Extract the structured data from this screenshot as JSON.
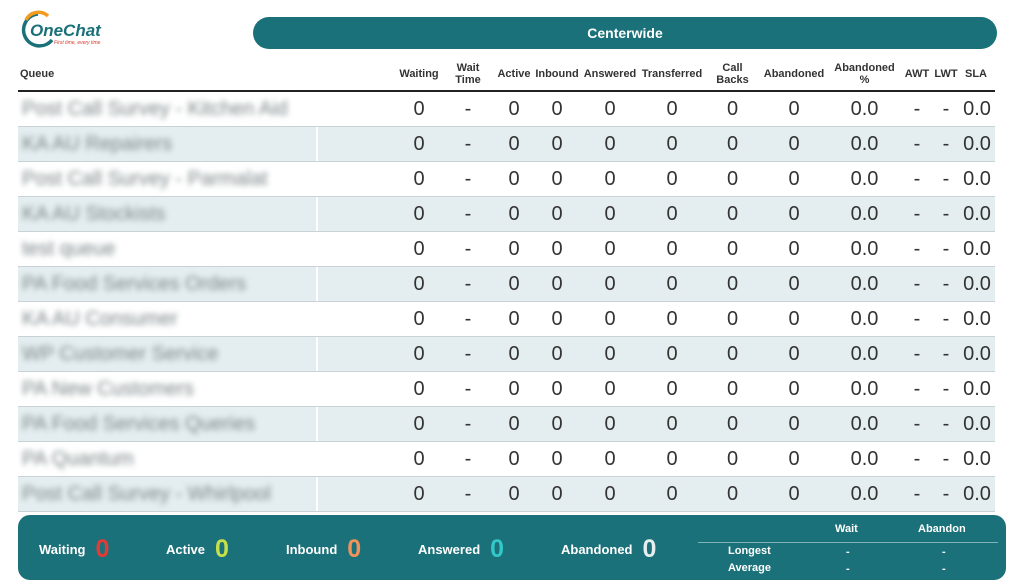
{
  "app": {
    "logo_text": "OneChat",
    "logo_tagline": "First time, every time"
  },
  "banner": {
    "title": "Centerwide"
  },
  "columns": {
    "queue": "Queue",
    "waiting": "Waiting",
    "wait_time": "Wait Time",
    "active": "Active",
    "inbound": "Inbound",
    "answered": "Answered",
    "transferred": "Transferred",
    "call_backs": "Call Backs",
    "abandoned": "Abandoned",
    "abandoned_pct": "Abandoned %",
    "awt": "AWT",
    "lwt": "LWT",
    "sla": "SLA"
  },
  "rows": [
    {
      "queue": "Post Call Survey - Kitchen Aid",
      "waiting": "0",
      "wait_time": "-",
      "active": "0",
      "inbound": "0",
      "answered": "0",
      "transferred": "0",
      "call_backs": "0",
      "abandoned": "0",
      "abandoned_pct": "0.0",
      "awt": "-",
      "lwt": "-",
      "sla": "0.0"
    },
    {
      "queue": "KA AU Repairers",
      "waiting": "0",
      "wait_time": "-",
      "active": "0",
      "inbound": "0",
      "answered": "0",
      "transferred": "0",
      "call_backs": "0",
      "abandoned": "0",
      "abandoned_pct": "0.0",
      "awt": "-",
      "lwt": "-",
      "sla": "0.0"
    },
    {
      "queue": "Post Call Survey - Parmalat",
      "waiting": "0",
      "wait_time": "-",
      "active": "0",
      "inbound": "0",
      "answered": "0",
      "transferred": "0",
      "call_backs": "0",
      "abandoned": "0",
      "abandoned_pct": "0.0",
      "awt": "-",
      "lwt": "-",
      "sla": "0.0"
    },
    {
      "queue": "KA AU Stockists",
      "waiting": "0",
      "wait_time": "-",
      "active": "0",
      "inbound": "0",
      "answered": "0",
      "transferred": "0",
      "call_backs": "0",
      "abandoned": "0",
      "abandoned_pct": "0.0",
      "awt": "-",
      "lwt": "-",
      "sla": "0.0"
    },
    {
      "queue": "test queue",
      "waiting": "0",
      "wait_time": "-",
      "active": "0",
      "inbound": "0",
      "answered": "0",
      "transferred": "0",
      "call_backs": "0",
      "abandoned": "0",
      "abandoned_pct": "0.0",
      "awt": "-",
      "lwt": "-",
      "sla": "0.0"
    },
    {
      "queue": "PA Food Services Orders",
      "waiting": "0",
      "wait_time": "-",
      "active": "0",
      "inbound": "0",
      "answered": "0",
      "transferred": "0",
      "call_backs": "0",
      "abandoned": "0",
      "abandoned_pct": "0.0",
      "awt": "-",
      "lwt": "-",
      "sla": "0.0"
    },
    {
      "queue": "KA AU Consumer",
      "waiting": "0",
      "wait_time": "-",
      "active": "0",
      "inbound": "0",
      "answered": "0",
      "transferred": "0",
      "call_backs": "0",
      "abandoned": "0",
      "abandoned_pct": "0.0",
      "awt": "-",
      "lwt": "-",
      "sla": "0.0"
    },
    {
      "queue": "WP Customer Service",
      "waiting": "0",
      "wait_time": "-",
      "active": "0",
      "inbound": "0",
      "answered": "0",
      "transferred": "0",
      "call_backs": "0",
      "abandoned": "0",
      "abandoned_pct": "0.0",
      "awt": "-",
      "lwt": "-",
      "sla": "0.0"
    },
    {
      "queue": "PA New Customers",
      "waiting": "0",
      "wait_time": "-",
      "active": "0",
      "inbound": "0",
      "answered": "0",
      "transferred": "0",
      "call_backs": "0",
      "abandoned": "0",
      "abandoned_pct": "0.0",
      "awt": "-",
      "lwt": "-",
      "sla": "0.0"
    },
    {
      "queue": "PA Food Services Queries",
      "waiting": "0",
      "wait_time": "-",
      "active": "0",
      "inbound": "0",
      "answered": "0",
      "transferred": "0",
      "call_backs": "0",
      "abandoned": "0",
      "abandoned_pct": "0.0",
      "awt": "-",
      "lwt": "-",
      "sla": "0.0"
    },
    {
      "queue": "PA Quantum",
      "waiting": "0",
      "wait_time": "-",
      "active": "0",
      "inbound": "0",
      "answered": "0",
      "transferred": "0",
      "call_backs": "0",
      "abandoned": "0",
      "abandoned_pct": "0.0",
      "awt": "-",
      "lwt": "-",
      "sla": "0.0"
    },
    {
      "queue": "Post Call Survey - Whirlpool",
      "waiting": "0",
      "wait_time": "-",
      "active": "0",
      "inbound": "0",
      "answered": "0",
      "transferred": "0",
      "call_backs": "0",
      "abandoned": "0",
      "abandoned_pct": "0.0",
      "awt": "-",
      "lwt": "-",
      "sla": "0.0"
    }
  ],
  "footer": {
    "stats": [
      {
        "label": "Waiting",
        "value": "0",
        "color": "#e53935"
      },
      {
        "label": "Active",
        "value": "0",
        "color": "#c6e04a"
      },
      {
        "label": "Inbound",
        "value": "0",
        "color": "#f0925a"
      },
      {
        "label": "Answered",
        "value": "0",
        "color": "#33c7c7"
      },
      {
        "label": "Abandoned",
        "value": "0",
        "color": "#e8eef0"
      }
    ],
    "summary": {
      "col_wait": "Wait",
      "col_abandon": "Abandon",
      "longest_label": "Longest",
      "average_label": "Average",
      "longest_wait": "-",
      "longest_abandon": "-",
      "average_wait": "-",
      "average_abandon": "-"
    }
  },
  "colors": {
    "accent": "#1b7179",
    "row_alt": "#e4eef0"
  }
}
